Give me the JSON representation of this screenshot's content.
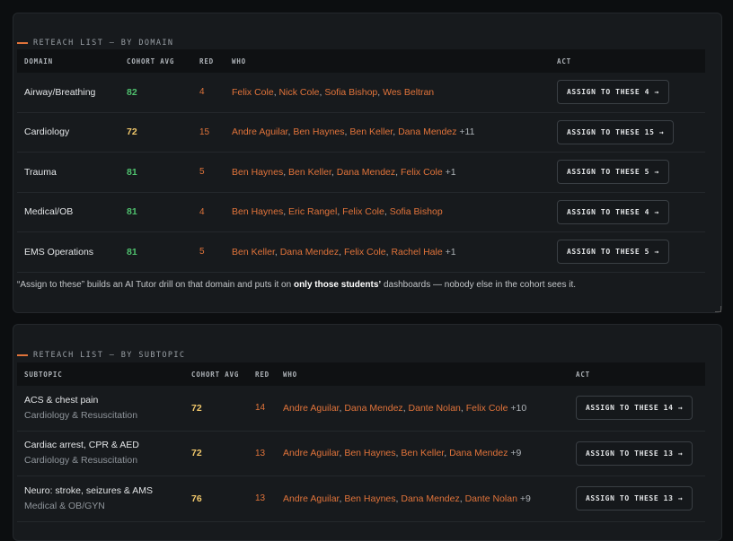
{
  "domain_section": {
    "label": "RETEACH LIST — BY DOMAIN",
    "headers": {
      "domain": "DOMAIN",
      "avg": "COHORT AVG",
      "red": "RED",
      "who": "WHO",
      "act": "ACT"
    },
    "rows": [
      {
        "domain": "Airway/Breathing",
        "avg": "82",
        "avg_color": "#4fc16e",
        "red": "4",
        "who": [
          "Felix Cole",
          "Nick Cole",
          "Sofia Bishop",
          "Wes Beltran"
        ],
        "more": "",
        "action": "ASSIGN TO THESE 4 →"
      },
      {
        "domain": "Cardiology",
        "avg": "72",
        "avg_color": "#f1c86b",
        "red": "15",
        "who": [
          "Andre Aguilar",
          "Ben Haynes",
          "Ben Keller",
          "Dana Mendez"
        ],
        "more": "+11",
        "action": "ASSIGN TO THESE 15 →"
      },
      {
        "domain": "Trauma",
        "avg": "81",
        "avg_color": "#4fc16e",
        "red": "5",
        "who": [
          "Ben Haynes",
          "Ben Keller",
          "Dana Mendez",
          "Felix Cole"
        ],
        "more": "+1",
        "action": "ASSIGN TO THESE 5 →"
      },
      {
        "domain": "Medical/OB",
        "avg": "81",
        "avg_color": "#4fc16e",
        "red": "4",
        "who": [
          "Ben Haynes",
          "Eric Rangel",
          "Felix Cole",
          "Sofia Bishop"
        ],
        "more": "",
        "action": "ASSIGN TO THESE 4 →"
      },
      {
        "domain": "EMS Operations",
        "avg": "81",
        "avg_color": "#4fc16e",
        "red": "5",
        "who": [
          "Ben Keller",
          "Dana Mendez",
          "Felix Cole",
          "Rachel Hale"
        ],
        "more": "+1",
        "action": "ASSIGN TO THESE 5 →"
      }
    ],
    "footnote_pre": "“Assign to these” builds an AI Tutor drill on that domain and puts it on ",
    "footnote_bold": "only those students’",
    "footnote_post": " dashboards — nobody else in the cohort sees it."
  },
  "subtopic_section": {
    "label": "RETEACH LIST — BY SUBTOPIC",
    "headers": {
      "subtopic": "SUBTOPIC",
      "avg": "COHORT AVG",
      "red": "RED",
      "who": "WHO",
      "act": "ACT"
    },
    "rows": [
      {
        "subtopic": "ACS & chest pain",
        "domain": "Cardiology & Resuscitation",
        "avg": "72",
        "avg_color": "#f1c86b",
        "red": "14",
        "who": [
          "Andre Aguilar",
          "Dana Mendez",
          "Dante Nolan",
          "Felix Cole"
        ],
        "more": "+10",
        "action": "ASSIGN TO THESE 14 →"
      },
      {
        "subtopic": "Cardiac arrest, CPR & AED",
        "domain": "Cardiology & Resuscitation",
        "avg": "72",
        "avg_color": "#f1c86b",
        "red": "13",
        "who": [
          "Andre Aguilar",
          "Ben Haynes",
          "Ben Keller",
          "Dana Mendez"
        ],
        "more": "+9",
        "action": "ASSIGN TO THESE 13 →"
      },
      {
        "subtopic": "Neuro: stroke, seizures & AMS",
        "domain": "Medical & OB/GYN",
        "avg": "76",
        "avg_color": "#f1c86b",
        "red": "13",
        "who": [
          "Andre Aguilar",
          "Ben Haynes",
          "Dana Mendez",
          "Dante Nolan"
        ],
        "more": "+9",
        "action": "ASSIGN TO THESE 13 →"
      }
    ]
  },
  "colors": {
    "accent": "#e0733a",
    "good": "#4fc16e",
    "warn": "#f1c86b"
  }
}
